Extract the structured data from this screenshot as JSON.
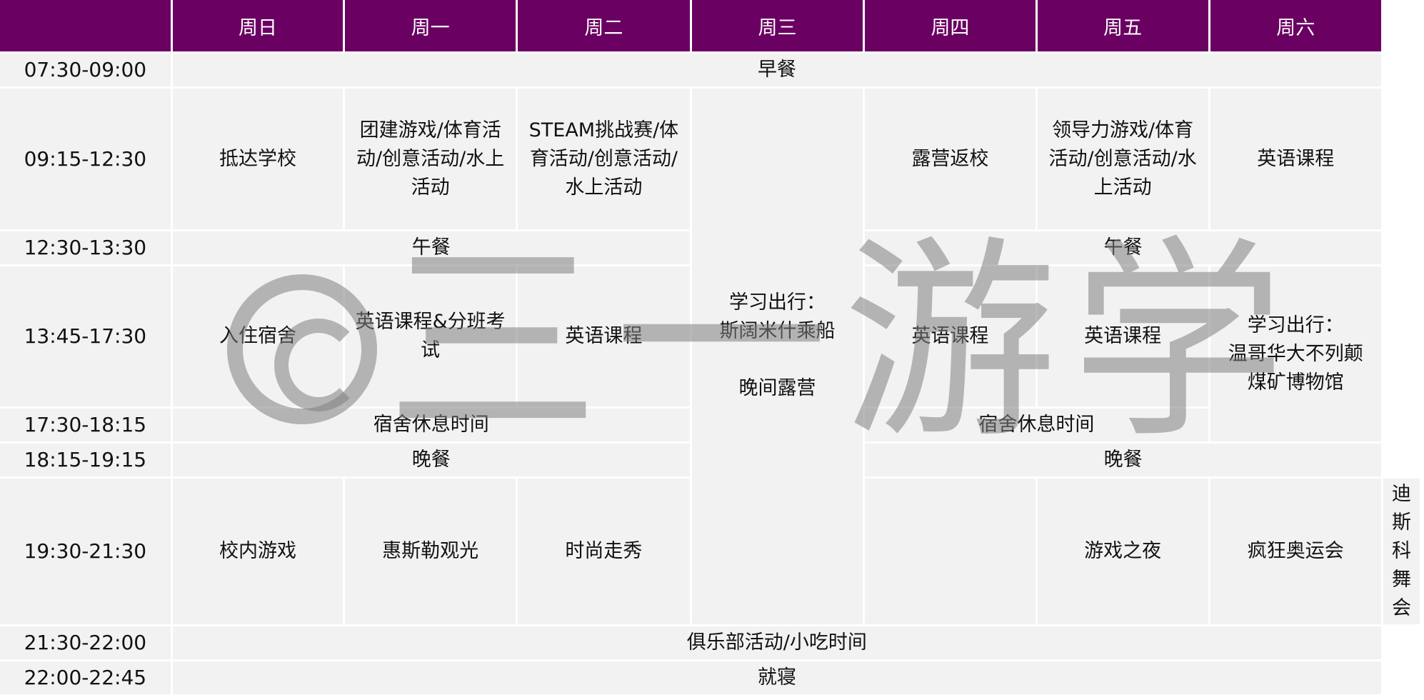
{
  "header": {
    "days": [
      "周日",
      "周一",
      "周二",
      "周三",
      "周四",
      "周五",
      "周六"
    ]
  },
  "times": [
    "07:30-09:00",
    "09:15-12:30",
    "12:30-13:30",
    "13:45-17:30",
    "17:30-18:15",
    "18:15-19:15",
    "19:30-21:30",
    "21:30-22:00",
    "22:00-22:45"
  ],
  "cells": {
    "breakfast": "早餐",
    "sun_morning": "抵达学校",
    "mon_morning": "团建游戏/体育活动/创意活动/水上活动",
    "tue_morning": "STEAM挑战赛/体育活动/创意活动/水上活动",
    "wed_trip": "学习出行：",
    "wed_trip_2": "斯阔米什乘船",
    "wed_evening": "晚间露营",
    "thu_morning": "露营返校",
    "fri_morning": "领导力游戏/体育活动/创意活动/水上活动",
    "sat_morning": "英语课程",
    "lunch_left": "午餐",
    "lunch_right": "午餐",
    "sun_afternoon": "入住宿舍",
    "mon_afternoon": "英语课程&分班考试",
    "tue_afternoon": "英语课程",
    "thu_afternoon": "英语课程",
    "fri_afternoon": "英语课程",
    "sat_trip": "学习出行：",
    "sat_trip_2": "温哥华大不列颠煤矿博物馆",
    "rest_left": "宿舍休息时间",
    "rest_right": "宿舍休息时间",
    "dinner_left": "晚餐",
    "dinner_right": "晚餐",
    "sun_evening": "校内游戏",
    "mon_evening": "惠斯勒观光",
    "tue_evening": "时尚走秀",
    "thu_evening": "游戏之夜",
    "fri_evening": "疯狂奥运会",
    "sat_evening": "迪斯科舞会",
    "club": "俱乐部活动/小吃时间",
    "bedtime": "就寝"
  },
  "watermark": "三一游学",
  "colors": {
    "header_bg": "#6a0061",
    "cell_bg": "#f2f2f2",
    "header_text": "#ffffff"
  }
}
